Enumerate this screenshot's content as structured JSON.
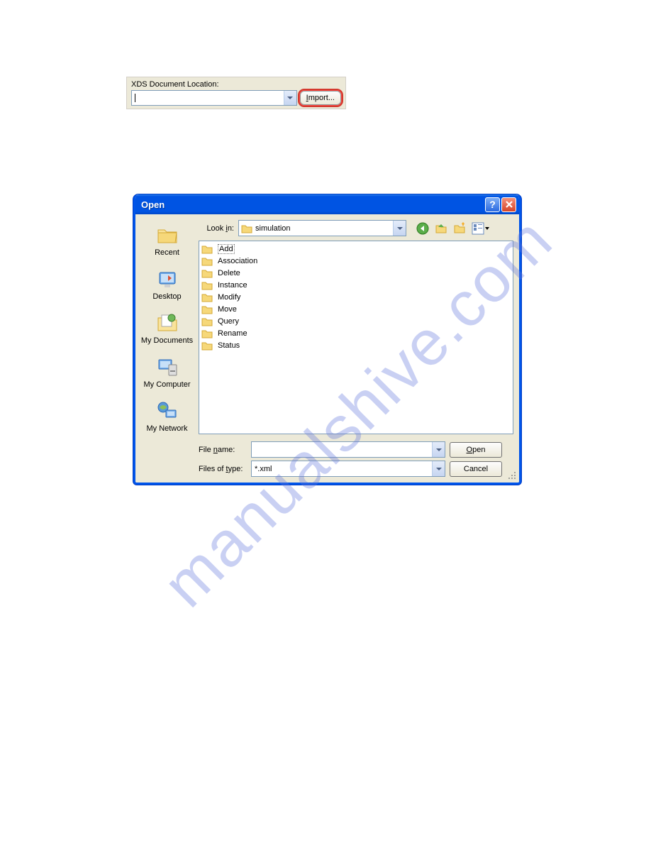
{
  "xds": {
    "label": "XDS Document Location:",
    "value": "",
    "import_label": "Import..."
  },
  "dialog": {
    "title": "Open",
    "lookin_label": "Look in:",
    "lookin_value": "simulation",
    "places": [
      {
        "label": "Recent"
      },
      {
        "label": "Desktop"
      },
      {
        "label": "My Documents"
      },
      {
        "label": "My Computer"
      },
      {
        "label": "My Network"
      }
    ],
    "folders": [
      "Add",
      "Association",
      "Delete",
      "Instance",
      "Modify",
      "Move",
      "Query",
      "Rename",
      "Status"
    ],
    "filename_label": "File name:",
    "filename_value": "",
    "filetype_label": "Files of type:",
    "filetype_value": "*.xml",
    "open_btn": "Open",
    "cancel_btn": "Cancel"
  },
  "watermark": "manualshive.com"
}
